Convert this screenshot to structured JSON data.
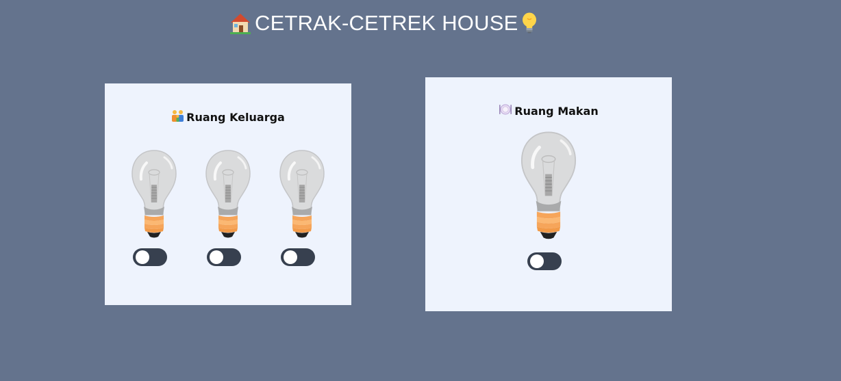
{
  "header": {
    "title": "CETRAK-CETREK HOUSE",
    "leading_icon": "house-icon",
    "trailing_icon": "lightbulb-icon"
  },
  "rooms": [
    {
      "name": "Ruang Keluarga",
      "icon": "family-icon",
      "lamps": [
        {
          "icon": "light-bulb-off",
          "on": false
        },
        {
          "icon": "light-bulb-off",
          "on": false
        },
        {
          "icon": "light-bulb-off",
          "on": false
        }
      ]
    },
    {
      "name": "Ruang Makan",
      "icon": "plate-cutlery-icon",
      "lamps": [
        {
          "icon": "light-bulb-off",
          "on": false
        }
      ]
    }
  ],
  "colors": {
    "background": "#64738d",
    "card": "#eef3fd",
    "toggle_track": "#37404f",
    "toggle_knob": "#ffffff",
    "bulb_base": "#f6a55a"
  }
}
